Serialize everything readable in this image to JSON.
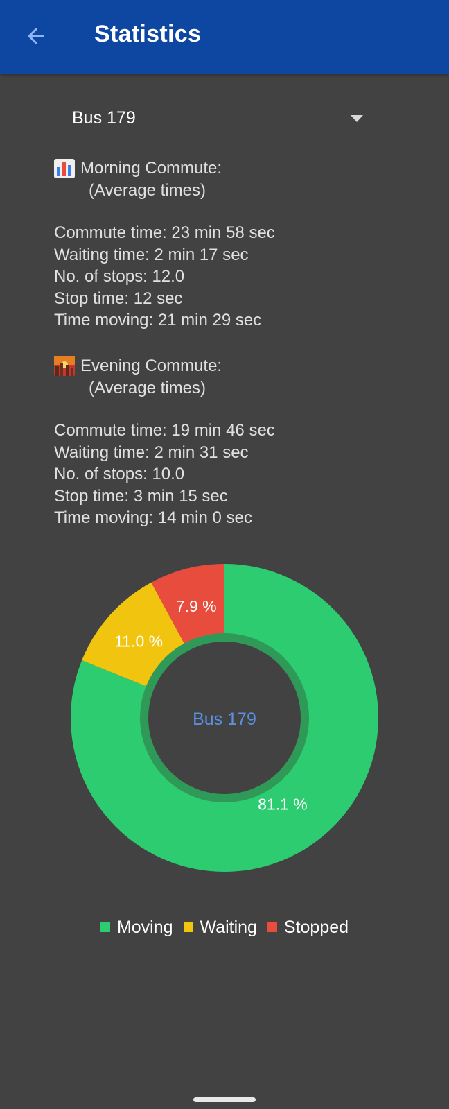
{
  "appbar": {
    "title": "Statistics",
    "back_icon": "arrow-back-icon",
    "color": "#0d47a1"
  },
  "selector": {
    "selected": "Bus 179"
  },
  "morning": {
    "icon": "bar-chart-icon",
    "heading": "Morning Commute:",
    "subheading": "(Average times)",
    "lines": [
      "Commute time: 23 min 58 sec",
      "Waiting time: 2 min 17 sec",
      "No. of stops: 12.0",
      "Stop time: 12 sec",
      "Time moving: 21 min 29 sec"
    ]
  },
  "evening": {
    "icon": "sunset-city-icon",
    "heading": "Evening Commute:",
    "subheading": "(Average times)",
    "lines": [
      "Commute time: 19 min 46 sec",
      "Waiting time: 2 min 31 sec",
      "No. of stops: 10.0",
      "Stop time: 3 min 15 sec",
      "Time moving: 14 min 0 sec"
    ]
  },
  "chart_data": {
    "type": "pie",
    "center_label": "Bus 179",
    "categories": [
      "Moving",
      "Waiting",
      "Stopped"
    ],
    "values": [
      81.1,
      11.0,
      7.9
    ],
    "value_labels": [
      "81.1 %",
      "11.0 %",
      "7.9 %"
    ],
    "colors": [
      "#2ecc71",
      "#f1c40f",
      "#e74c3c"
    ],
    "legend_position": "bottom-center"
  },
  "colors": {
    "background": "#424242",
    "center_label": "#5b8fe0"
  }
}
